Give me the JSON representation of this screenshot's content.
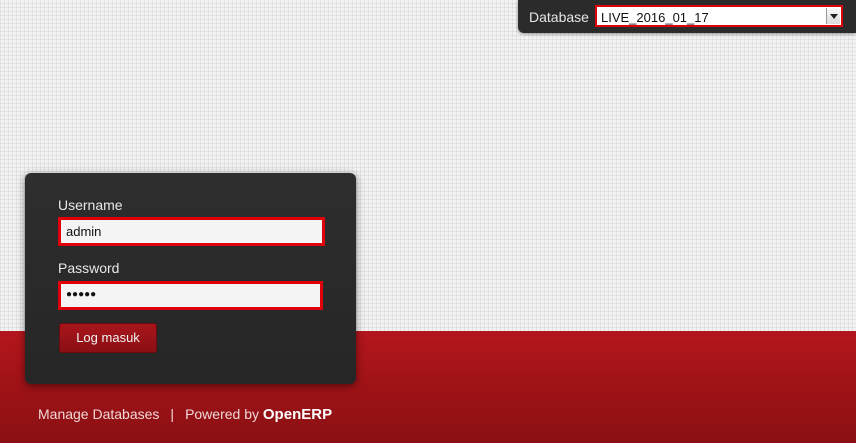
{
  "database": {
    "label": "Database",
    "selected": "LIVE_2016_01_17"
  },
  "login": {
    "username_label": "Username",
    "username_value": "admin",
    "password_label": "Password",
    "password_masked": "●●●●●",
    "submit_label": "Log masuk"
  },
  "footer": {
    "manage_label": "Manage Databases",
    "separator": "|",
    "powered_label": "Powered by",
    "brand": "OpenERP"
  },
  "colors": {
    "accent_red": "#b3161c",
    "highlight_red": "#e0000a",
    "panel_dark": "#2b2b2b"
  }
}
